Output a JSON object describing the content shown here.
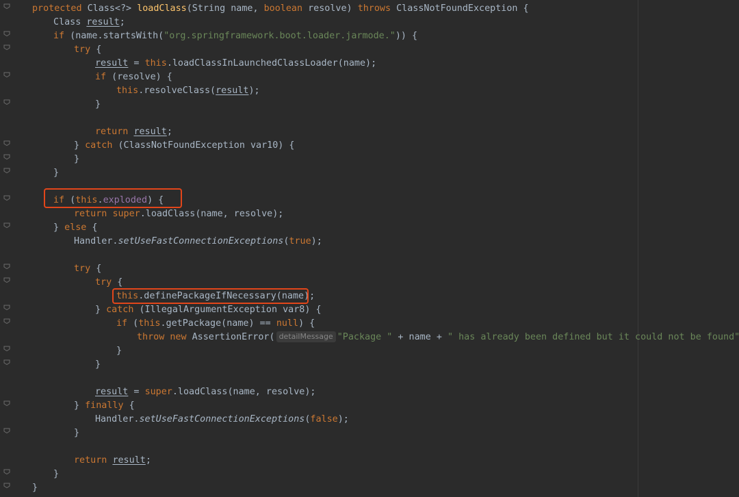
{
  "editor": {
    "colors": {
      "background": "#2b2b2b",
      "keyword": "#cc7832",
      "function": "#ffc66d",
      "string": "#6a8759",
      "field": "#9876aa",
      "text": "#a9b7c6",
      "highlight_box": "#e2461a"
    },
    "lines": {
      "l01": {
        "kw1": "protected",
        "t1": " Class<?> ",
        "fn": "loadClass",
        "t2": "(String name, ",
        "kw2": "boolean",
        "t3": " resolve) ",
        "kw3": "throws",
        "t4": " ClassNotFoundException {"
      },
      "l02": {
        "t1": "Class ",
        "var": "result",
        "t2": ";"
      },
      "l03": {
        "kw1": "if",
        "t1": " (name.startsWith(",
        "str": "\"org.springframework.boot.loader.jarmode.\"",
        "t2": ")) {"
      },
      "l04": {
        "kw1": "try",
        "t1": " {"
      },
      "l05": {
        "var": "result",
        "t1": " = ",
        "kw1": "this",
        "t2": ".loadClassInLaunchedClassLoader(name);"
      },
      "l06": {
        "kw1": "if",
        "t1": " (resolve) {"
      },
      "l07": {
        "kw1": "this",
        "t1": ".resolveClass(",
        "var": "result",
        "t2": ");"
      },
      "l08": {
        "t1": "}"
      },
      "l10": {
        "kw1": "return",
        "t1": " ",
        "var": "result",
        "t2": ";"
      },
      "l11": {
        "t1": "} ",
        "kw1": "catch",
        "t2": " (ClassNotFoundException var10) {"
      },
      "l12": {
        "t1": "}"
      },
      "l13": {
        "t1": "}"
      },
      "l15": {
        "kw1": "if",
        "t1": " (",
        "kw2": "this",
        "t2": ".",
        "fld": "exploded",
        "t3": ") {"
      },
      "l16": {
        "kw1": "return",
        "t1": " ",
        "kw2": "super",
        "t2": ".loadClass(name, resolve);"
      },
      "l17": {
        "t1": "} ",
        "kw1": "else",
        "t2": " {"
      },
      "l18": {
        "t1": "Handler.",
        "it": "setUseFastConnectionExceptions",
        "t2": "(",
        "kw1": "true",
        "t3": ");"
      },
      "l20": {
        "kw1": "try",
        "t1": " {"
      },
      "l21": {
        "kw1": "try",
        "t1": " {"
      },
      "l22": {
        "kw1": "this",
        "t1": ".definePackageIfNecessary(name);"
      },
      "l23": {
        "t1": "} ",
        "kw1": "catch",
        "t2": " (IllegalArgumentException var8) {"
      },
      "l24": {
        "kw1": "if",
        "t1": " (",
        "kw2": "this",
        "t2": ".getPackage(name) == ",
        "kw3": "null",
        "t3": ") {"
      },
      "l25": {
        "kw1": "throw",
        "t1": " ",
        "kw2": "new",
        "t2": " AssertionError(",
        "hint": "detailMessage",
        "str1": "\"Package \"",
        "t3": " + name + ",
        "str2": "\" has already been defined but it could not be found\"",
        "t4": ");"
      },
      "l26": {
        "t1": "}"
      },
      "l27": {
        "t1": "}"
      },
      "l29": {
        "var": "result",
        "t1": " = ",
        "kw1": "super",
        "t2": ".loadClass(name, resolve);"
      },
      "l30": {
        "t1": "} ",
        "kw1": "finally",
        "t2": " {"
      },
      "l31": {
        "t1": "Handler.",
        "it": "setUseFastConnectionExceptions",
        "t2": "(",
        "kw1": "false",
        "t3": ");"
      },
      "l32": {
        "t1": "}"
      },
      "l34": {
        "kw1": "return",
        "t1": " ",
        "var": "result",
        "t2": ";"
      },
      "l35": {
        "t1": "}"
      },
      "l36": {
        "t1": "}"
      }
    }
  }
}
